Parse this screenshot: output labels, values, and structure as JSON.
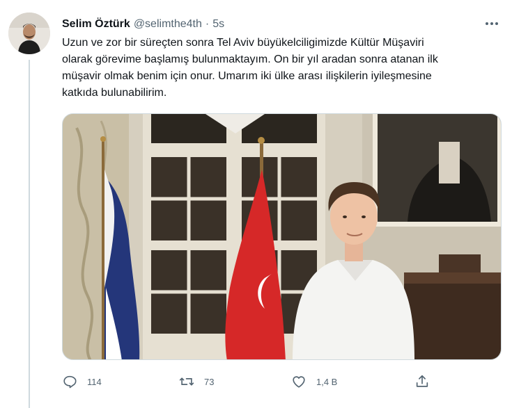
{
  "tweet": {
    "author_name": "Selim Öztürk",
    "handle": "@selimthe4th",
    "separator": "·",
    "time": "5s",
    "text": "Uzun ve zor bir süreçten sonra Tel Aviv büyükelciligimizde Kültür Müşaviri\nolarak görevime başlamış bulunmaktayım. On bir yıl aradan sonra atanan ilk\nmüşavir olmak benim için onur. Umarım iki ülke arası ilişkilerin iyileşmesine\nkatkıda bulunabilirim.",
    "metrics": {
      "replies": "114",
      "retweets": "73",
      "likes": "1,4 B"
    }
  },
  "icons": {
    "more": "more-icon",
    "reply": "reply-icon",
    "retweet": "retweet-icon",
    "like": "heart-icon",
    "share": "share-icon"
  },
  "colors": {
    "text": "#0f1419",
    "muted": "#536471",
    "border": "#cfd9de",
    "flag_red": "#d62828",
    "flag_blue": "#24367a"
  }
}
